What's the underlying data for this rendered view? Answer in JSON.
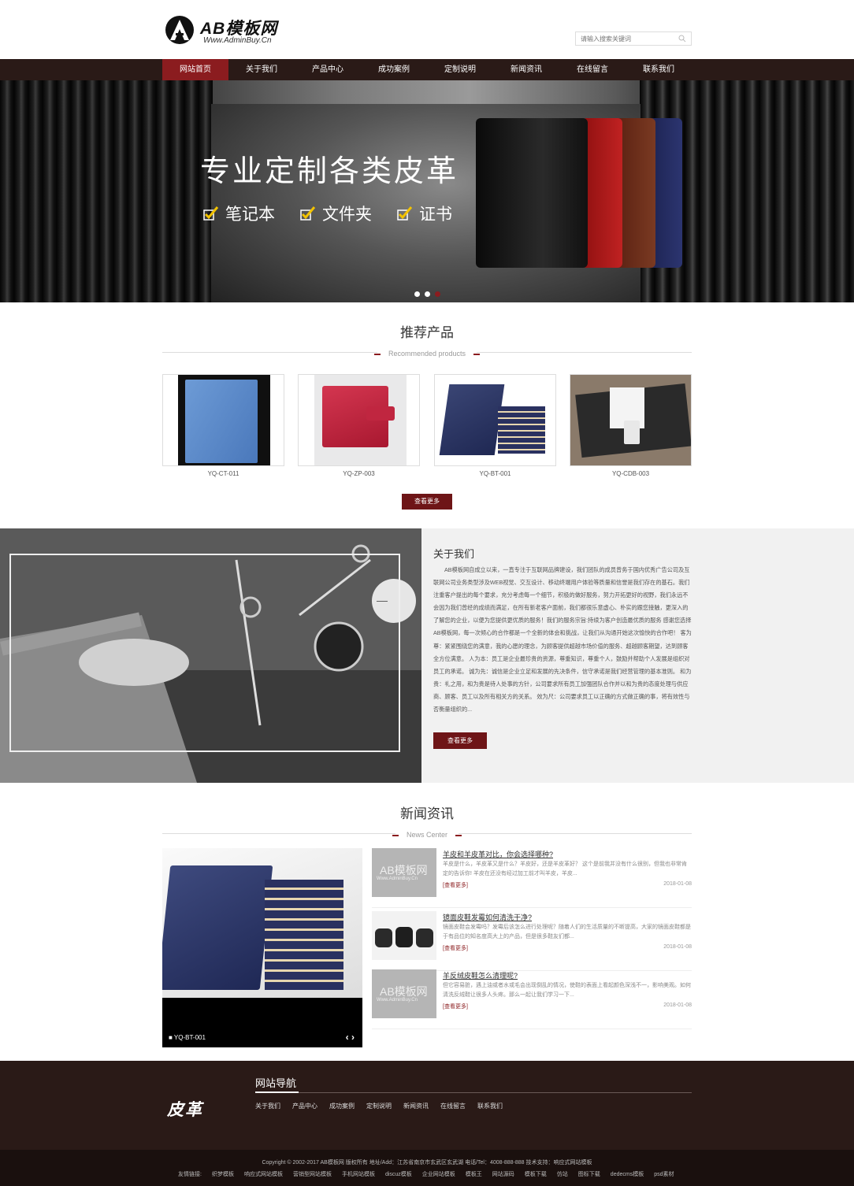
{
  "header": {
    "logo_text": "AB模板网",
    "logo_sub": "Www.AdminBuy.Cn",
    "search_placeholder": "请输入搜索关键词"
  },
  "nav": {
    "items": [
      "网站首页",
      "关于我们",
      "产品中心",
      "成功案例",
      "定制说明",
      "新闻资讯",
      "在线留言",
      "联系我们"
    ]
  },
  "banner": {
    "title": "专业定制各类皮革",
    "features": [
      "笔记本",
      "文件夹",
      "证书"
    ],
    "folder_colors": [
      "#111111",
      "#b01a1a",
      "#6a2a1a",
      "#1c2250"
    ]
  },
  "products_section": {
    "title": "推荐产品",
    "subtitle": "Recommended products",
    "items": [
      {
        "code": "YQ-CT-011"
      },
      {
        "code": "YQ-ZP-003"
      },
      {
        "code": "YQ-BT-001"
      },
      {
        "code": "YQ-CDB-003"
      }
    ],
    "more_label": "查看更多"
  },
  "about": {
    "title": "关于我们",
    "text": "AB模板网自成立以来，一直专注于互联网品牌建设，我们团队的成员曾务于国内优秀广告公司及互联网公司业务类型涉及WEB视觉、交互设计、移动终端用户体验等质量和信誉是我们存在的基石。我们注重客户提出的每个要求，充分考虑每一个细节，积极的做好服务，努力开拓更好的视野，我们永远不会因为我们曾经的成绩而满足，在所有新老客户面前，我们都很乐意虚心、朴实的跟您接触，更深入的了解您的企业，以便为您提供更优质的服务！我们的服务宗旨:持续为客户创造最优质的服务 感谢您选择AB模板网，每一次倾心的合作都是一个全新的体会和挑战，让我们从沟通开始这次愉快的合作吧！ 客为尊：紧紧围绕您的满意，我的心愿的理念，为顾客提供超越市场价值的服务、超越顾客期望，达到顾客全方位满意。 人为本：员工是企业最珍贵的资源，尊重知识，尊重个人，鼓励并帮助个人发展是组织对员工的承诺。 诚为先：诚信是企业立足和发展的先决条件，信守承诺是我们经营管理的基本准则。 和为贵：礼之用，和为贵是待人处事的方针，公司要求所有员工加强团队合作并以和为贵的态度处理与供应商、顾客、员工以及所有相关方的关系。 效为尺：公司要求员工以正确的方式做正确的事，将有效性与否衡量组织的...",
    "more_label": "查看更多"
  },
  "news_section": {
    "title": "新闻资讯",
    "subtitle": "News Center",
    "feature_caption": "YQ-BT-001",
    "items": [
      {
        "title": "羊皮和羊皮革对比，你会选择哪种?",
        "desc": "羊皮是什么，羊皮革又是什么？羊皮好，还是羊皮革好？ 这个是前我并没有什么很别，但我也非常肯定的告诉你! 羊皮在还没有经过加工前才叫羊皮，羊皮...",
        "more": "[查看更多]",
        "date": "2018-01-08"
      },
      {
        "title": "镜面皮鞋发霉如何清洗干净?",
        "desc": "镜面皮鞋会发霉吗？发霉后该怎么进行处理呢？随着人们的生活质量的不断提高，大家的镜面皮鞋都是于有品位的知名度高大上的产品，但是很多鞋友们都...",
        "more": "[查看更多]",
        "date": "2018-01-08"
      },
      {
        "title": "羊反绒皮鞋怎么清理呢?",
        "desc": "但它容易脏，遇上油或者水或毛会出现倒乱的情况，使鞋的表面上看起颜色深浅不一，影响美观。如何清洗反绒鞋让很多人头疼。那么一起让我们学习一下...",
        "more": "[查看更多]",
        "date": "2018-01-08"
      }
    ],
    "thumb_text": "AB模板网",
    "thumb_sub": "Www.AdminBuy.Cn"
  },
  "footer": {
    "logo": "皮革",
    "nav_title": "网站导航",
    "links": [
      "关于我们",
      "产品中心",
      "成功案例",
      "定制说明",
      "新闻资讯",
      "在线留言",
      "联系我们"
    ],
    "copyright": "Copyright © 2002-2017 AB模板网 版权所有 地址/Add：江苏省南京市玄武区玄武湖 电话/Tel：4008-888-888 技术支持：响应式网站模板",
    "friend_label": "友情链接:",
    "friend_links": [
      "织梦模板",
      "响应式网站模板",
      "营销型网站模板",
      "手机网站模板",
      "discuz模板",
      "企业网站模板",
      "模板王",
      "网站源码",
      "模板下载",
      "仿站",
      "图标下载",
      "dedecms模板",
      "psd素材"
    ]
  }
}
